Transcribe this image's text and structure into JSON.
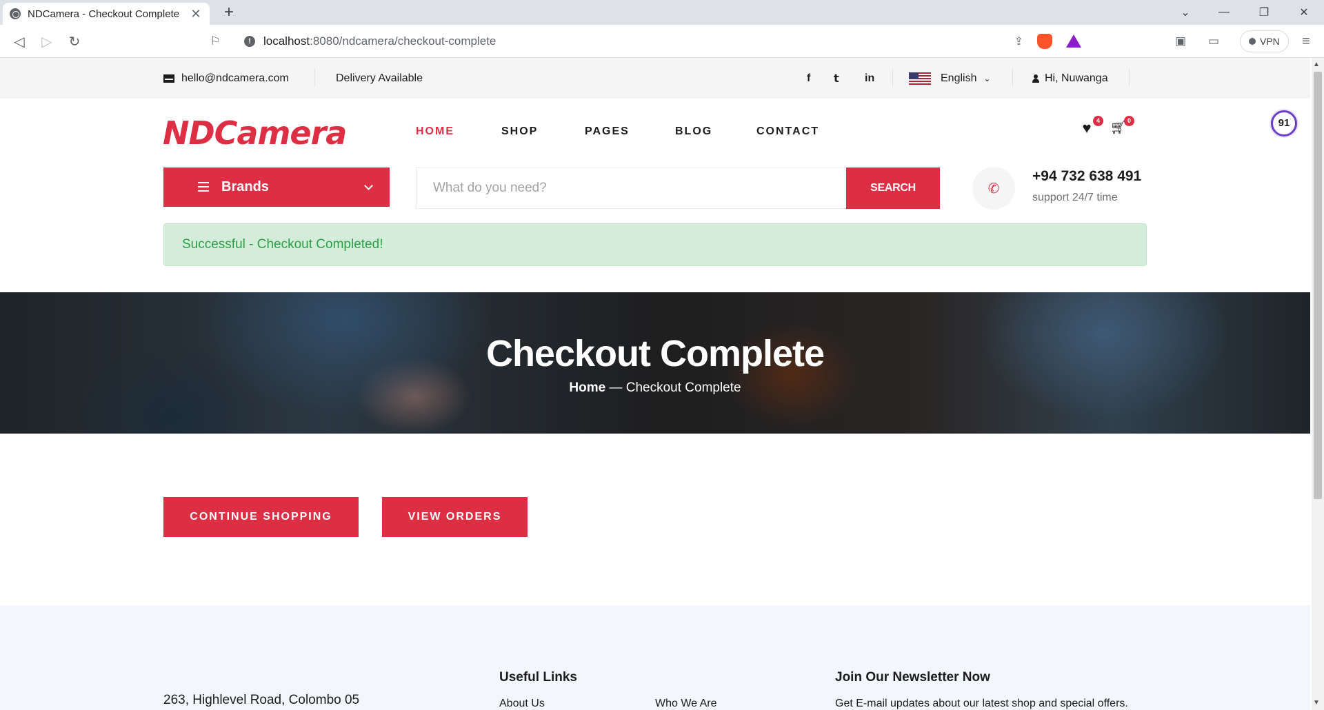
{
  "browser": {
    "tab_title": "NDCamera - Checkout Complete",
    "tab_close": "✕",
    "new_tab": "+",
    "url_host": "localhost",
    "url_path": ":8080/ndcamera/checkout-complete",
    "vpn_label": "VPN"
  },
  "topbar": {
    "email": "hello@ndcamera.com",
    "delivery": "Delivery Available",
    "social": [
      "f",
      "t",
      "in"
    ],
    "language": "English",
    "greeting": "Hi, Nuwanga"
  },
  "header": {
    "logo": "NDCamera",
    "nav": [
      "HOME",
      "SHOP",
      "PAGES",
      "BLOG",
      "CONTACT"
    ],
    "wishlist_count": "4",
    "cart_count": "0",
    "score_badge": "91"
  },
  "search": {
    "brands_label": "Brands",
    "placeholder": "What do you need?",
    "button": "SEARCH",
    "phone": "+94 732 638 491",
    "support": "support 24/7 time"
  },
  "alert": {
    "message": "Successful - Checkout Completed!"
  },
  "hero": {
    "title": "Checkout Complete",
    "crumb_home": "Home",
    "crumb_current": "Checkout Complete"
  },
  "actions": {
    "continue": "CONTINUE SHOPPING",
    "orders": "VIEW ORDERS"
  },
  "footer": {
    "address": "263, Highlevel Road, Colombo 05",
    "useful_links_title": "Useful Links",
    "link1": "About Us",
    "link2": "Who We Are",
    "newsletter_title": "Join Our Newsletter Now",
    "newsletter_text": "Get E-mail updates about our latest shop and special offers."
  },
  "colors": {
    "accent": "#dd2f44",
    "alert_bg": "#d4edda",
    "alert_text": "#2aa044",
    "footer_bg": "#f3f6fa"
  }
}
